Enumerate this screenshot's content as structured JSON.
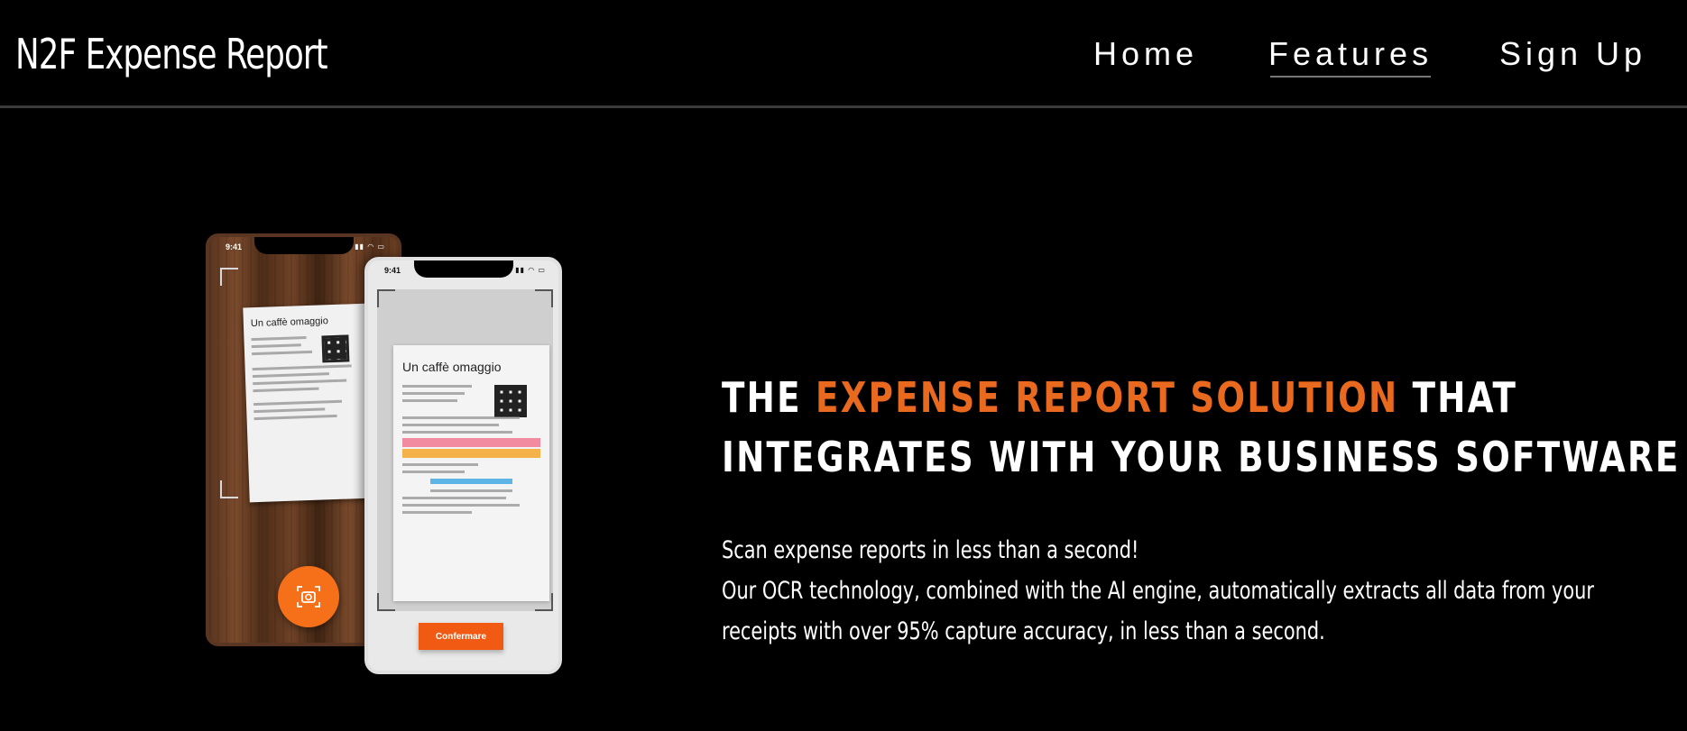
{
  "header": {
    "brand": "N2F Expense Report",
    "nav": [
      {
        "label": "Home"
      },
      {
        "label": "Features",
        "active": true
      },
      {
        "label": "Sign Up"
      }
    ]
  },
  "hero": {
    "headline_part1": "THE ",
    "headline_accent": "EXPENSE REPORT SOLUTION",
    "headline_part2": " THAT",
    "headline_line2": "INTEGRATES WITH YOUR BUSINESS SOFTWARE",
    "description_line1": "Scan expense reports in less than a second!",
    "description_line2": "Our OCR technology, combined with the AI engine, automatically extracts all data from your",
    "description_line3": "receipts with over 95% capture accuracy, in less than a second.",
    "accent_color": "#e9691f",
    "phones": {
      "status_time": "9:41",
      "receipt_title": "Un caffè omaggio",
      "confirm_label": "Confermare",
      "shutter_icon": "camera-icon"
    }
  }
}
